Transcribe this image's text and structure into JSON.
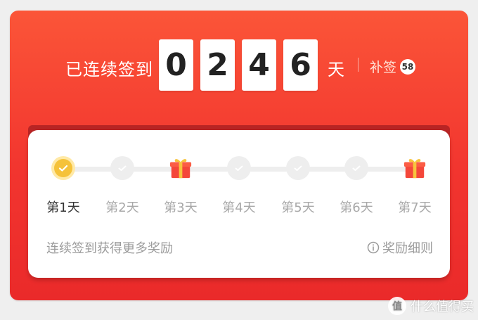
{
  "header": {
    "prefix": "已连续签到",
    "digits": [
      "0",
      "2",
      "4",
      "6"
    ],
    "unit": "天",
    "makeup_label": "补签",
    "makeup_count": "58"
  },
  "steps": [
    {
      "label": "第1天",
      "state": "done"
    },
    {
      "label": "第2天",
      "state": "todo"
    },
    {
      "label": "第3天",
      "state": "gift"
    },
    {
      "label": "第4天",
      "state": "todo"
    },
    {
      "label": "第5天",
      "state": "todo"
    },
    {
      "label": "第6天",
      "state": "todo"
    },
    {
      "label": "第7天",
      "state": "gift"
    }
  ],
  "footer": {
    "tip": "连续签到获得更多奖励",
    "rules": "奖励细则"
  },
  "watermark": {
    "badge": "值",
    "text": "什么值得买"
  },
  "colors": {
    "accent_red": "#f2352f",
    "gold": "#f5c23a",
    "muted_text": "#9b9b9b"
  }
}
